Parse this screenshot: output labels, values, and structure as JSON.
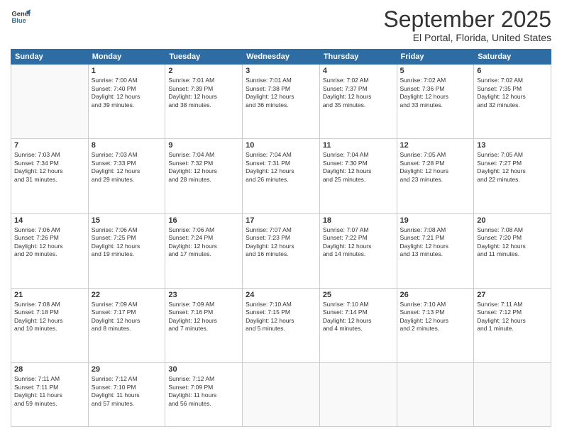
{
  "logo": {
    "line1": "General",
    "line2": "Blue"
  },
  "header": {
    "month": "September 2025",
    "location": "El Portal, Florida, United States"
  },
  "weekdays": [
    "Sunday",
    "Monday",
    "Tuesday",
    "Wednesday",
    "Thursday",
    "Friday",
    "Saturday"
  ],
  "weeks": [
    [
      {
        "day": "",
        "content": ""
      },
      {
        "day": "1",
        "content": "Sunrise: 7:00 AM\nSunset: 7:40 PM\nDaylight: 12 hours\nand 39 minutes."
      },
      {
        "day": "2",
        "content": "Sunrise: 7:01 AM\nSunset: 7:39 PM\nDaylight: 12 hours\nand 38 minutes."
      },
      {
        "day": "3",
        "content": "Sunrise: 7:01 AM\nSunset: 7:38 PM\nDaylight: 12 hours\nand 36 minutes."
      },
      {
        "day": "4",
        "content": "Sunrise: 7:02 AM\nSunset: 7:37 PM\nDaylight: 12 hours\nand 35 minutes."
      },
      {
        "day": "5",
        "content": "Sunrise: 7:02 AM\nSunset: 7:36 PM\nDaylight: 12 hours\nand 33 minutes."
      },
      {
        "day": "6",
        "content": "Sunrise: 7:02 AM\nSunset: 7:35 PM\nDaylight: 12 hours\nand 32 minutes."
      }
    ],
    [
      {
        "day": "7",
        "content": "Sunrise: 7:03 AM\nSunset: 7:34 PM\nDaylight: 12 hours\nand 31 minutes."
      },
      {
        "day": "8",
        "content": "Sunrise: 7:03 AM\nSunset: 7:33 PM\nDaylight: 12 hours\nand 29 minutes."
      },
      {
        "day": "9",
        "content": "Sunrise: 7:04 AM\nSunset: 7:32 PM\nDaylight: 12 hours\nand 28 minutes."
      },
      {
        "day": "10",
        "content": "Sunrise: 7:04 AM\nSunset: 7:31 PM\nDaylight: 12 hours\nand 26 minutes."
      },
      {
        "day": "11",
        "content": "Sunrise: 7:04 AM\nSunset: 7:30 PM\nDaylight: 12 hours\nand 25 minutes."
      },
      {
        "day": "12",
        "content": "Sunrise: 7:05 AM\nSunset: 7:28 PM\nDaylight: 12 hours\nand 23 minutes."
      },
      {
        "day": "13",
        "content": "Sunrise: 7:05 AM\nSunset: 7:27 PM\nDaylight: 12 hours\nand 22 minutes."
      }
    ],
    [
      {
        "day": "14",
        "content": "Sunrise: 7:06 AM\nSunset: 7:26 PM\nDaylight: 12 hours\nand 20 minutes."
      },
      {
        "day": "15",
        "content": "Sunrise: 7:06 AM\nSunset: 7:25 PM\nDaylight: 12 hours\nand 19 minutes."
      },
      {
        "day": "16",
        "content": "Sunrise: 7:06 AM\nSunset: 7:24 PM\nDaylight: 12 hours\nand 17 minutes."
      },
      {
        "day": "17",
        "content": "Sunrise: 7:07 AM\nSunset: 7:23 PM\nDaylight: 12 hours\nand 16 minutes."
      },
      {
        "day": "18",
        "content": "Sunrise: 7:07 AM\nSunset: 7:22 PM\nDaylight: 12 hours\nand 14 minutes."
      },
      {
        "day": "19",
        "content": "Sunrise: 7:08 AM\nSunset: 7:21 PM\nDaylight: 12 hours\nand 13 minutes."
      },
      {
        "day": "20",
        "content": "Sunrise: 7:08 AM\nSunset: 7:20 PM\nDaylight: 12 hours\nand 11 minutes."
      }
    ],
    [
      {
        "day": "21",
        "content": "Sunrise: 7:08 AM\nSunset: 7:18 PM\nDaylight: 12 hours\nand 10 minutes."
      },
      {
        "day": "22",
        "content": "Sunrise: 7:09 AM\nSunset: 7:17 PM\nDaylight: 12 hours\nand 8 minutes."
      },
      {
        "day": "23",
        "content": "Sunrise: 7:09 AM\nSunset: 7:16 PM\nDaylight: 12 hours\nand 7 minutes."
      },
      {
        "day": "24",
        "content": "Sunrise: 7:10 AM\nSunset: 7:15 PM\nDaylight: 12 hours\nand 5 minutes."
      },
      {
        "day": "25",
        "content": "Sunrise: 7:10 AM\nSunset: 7:14 PM\nDaylight: 12 hours\nand 4 minutes."
      },
      {
        "day": "26",
        "content": "Sunrise: 7:10 AM\nSunset: 7:13 PM\nDaylight: 12 hours\nand 2 minutes."
      },
      {
        "day": "27",
        "content": "Sunrise: 7:11 AM\nSunset: 7:12 PM\nDaylight: 12 hours\nand 1 minute."
      }
    ],
    [
      {
        "day": "28",
        "content": "Sunrise: 7:11 AM\nSunset: 7:11 PM\nDaylight: 11 hours\nand 59 minutes."
      },
      {
        "day": "29",
        "content": "Sunrise: 7:12 AM\nSunset: 7:10 PM\nDaylight: 11 hours\nand 57 minutes."
      },
      {
        "day": "30",
        "content": "Sunrise: 7:12 AM\nSunset: 7:09 PM\nDaylight: 11 hours\nand 56 minutes."
      },
      {
        "day": "",
        "content": ""
      },
      {
        "day": "",
        "content": ""
      },
      {
        "day": "",
        "content": ""
      },
      {
        "day": "",
        "content": ""
      }
    ]
  ]
}
